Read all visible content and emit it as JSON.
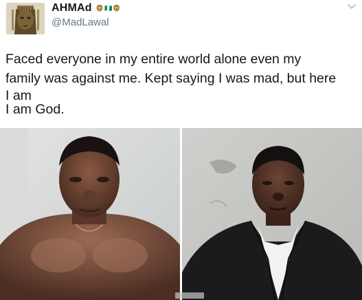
{
  "tweet": {
    "display_name": "AHMAd",
    "name_emojis": "🦁🇳🇬🦁",
    "handle": "@MadLawal",
    "text_lines": [
      "Faced everyone in my entire world alone even my",
      "family was against me. Kept saying I was mad, but here",
      "I am",
      "I am God."
    ],
    "media": {
      "photos": [
        "shirtless-selfie",
        "suit-portrait"
      ]
    }
  },
  "colors": {
    "text": "#14171a",
    "secondary": "#657786",
    "background": "#ffffff"
  },
  "icons": {
    "menu": "chevron-down-icon"
  }
}
